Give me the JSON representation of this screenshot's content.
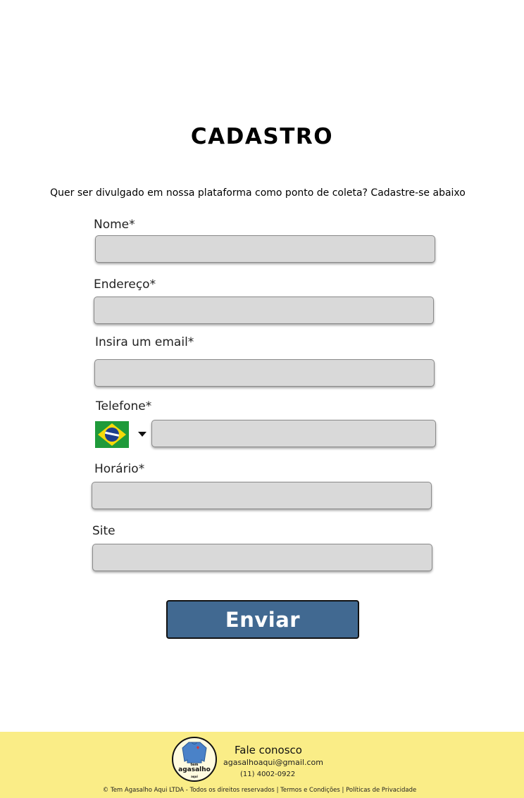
{
  "page": {
    "title": "CADASTRO",
    "subtitle": "Quer ser divulgado em nossa plataforma como ponto de coleta? Cadastre-se abaixo"
  },
  "form": {
    "nome": {
      "label": "Nome*",
      "value": ""
    },
    "endereco": {
      "label": "Endereço*",
      "value": ""
    },
    "email": {
      "label": "Insira um email*",
      "value": ""
    },
    "telefone": {
      "label": "Telefone*",
      "value": "",
      "country_flag": "brazil-flag-icon"
    },
    "horario": {
      "label": "Horário*",
      "value": ""
    },
    "site": {
      "label": "Site",
      "value": ""
    },
    "submit_label": "Enviar",
    "submit_color": "#416991"
  },
  "footer": {
    "background": "#faed87",
    "logo": {
      "line1": "tem",
      "line2": "agasalho",
      "line3": "aqui"
    },
    "contact_title": "Fale conosco",
    "email": "agasalhoaqui@gmail.com",
    "phone": "(11) 4002-0922",
    "copyright": "© Tem Agasalho Aqui LTDA - Todos os direitos reservados",
    "terms": "Termos e Condições",
    "privacy": "Políticas de Privacidade"
  }
}
